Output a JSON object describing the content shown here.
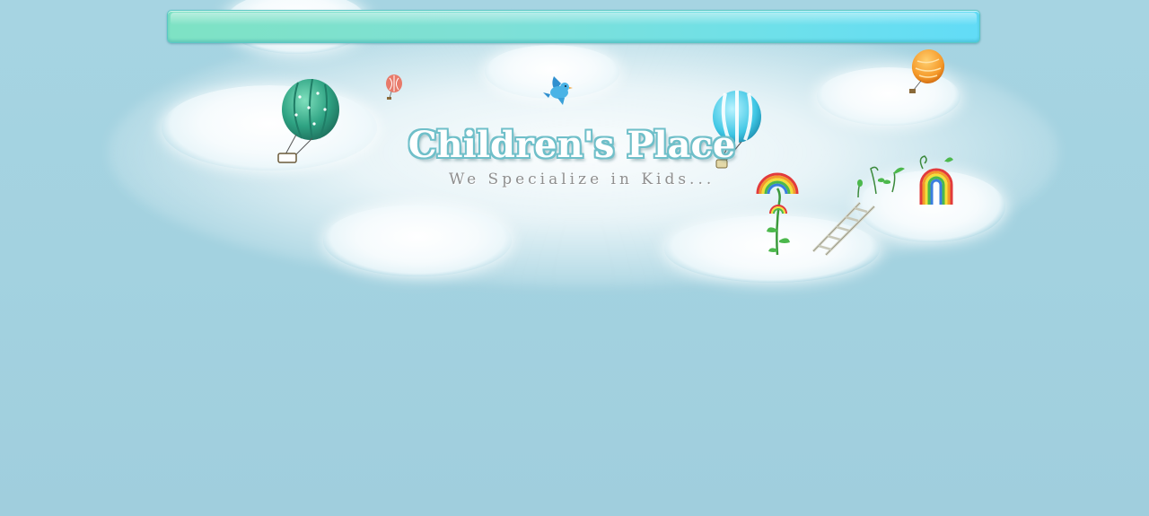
{
  "header": {
    "site_title": "Children's Place",
    "tagline": "We Specialize in Kids..."
  },
  "colors": {
    "background": "#a0cfde",
    "nav_bar_left": "#7ee2c4",
    "nav_bar_right": "#62dcf7",
    "title_outline": "#6fbfc9",
    "tagline_text": "#8f8f8f"
  },
  "decorations": {
    "icons": [
      "hot-air-balloon-green-icon",
      "hot-air-balloon-small-red-icon",
      "bird-icon",
      "hot-air-balloon-blue-icon",
      "hot-air-balloon-orange-icon",
      "rainbow-flower-icon",
      "ladder-icon",
      "sprouts-icon",
      "rainbow-arch-icon"
    ]
  }
}
